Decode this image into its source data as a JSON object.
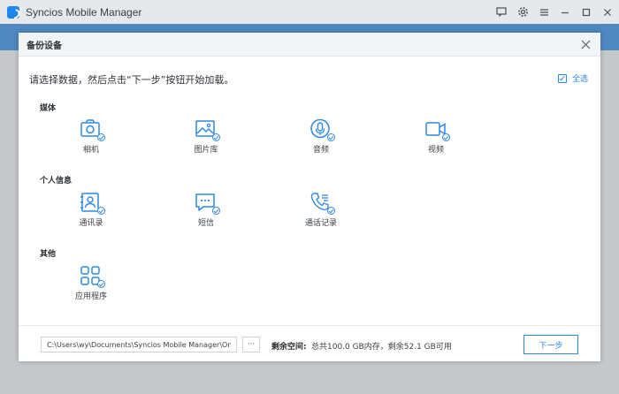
{
  "app": {
    "title": "Syncios Mobile Manager"
  },
  "dialog": {
    "title": "备份设备",
    "instruction": "请选择数据，然后点击“下一步”按钮开始加载。",
    "select_all_label": "全选",
    "sections": {
      "media": {
        "label": "媒体",
        "items": [
          {
            "label": "相机",
            "icon": "camera-icon"
          },
          {
            "label": "图片库",
            "icon": "photo-icon"
          },
          {
            "label": "音频",
            "icon": "microphone-icon"
          },
          {
            "label": "视频",
            "icon": "video-icon"
          }
        ]
      },
      "personal": {
        "label": "个人信息",
        "items": [
          {
            "label": "通讯录",
            "icon": "contacts-icon"
          },
          {
            "label": "短信",
            "icon": "message-icon"
          },
          {
            "label": "通话记录",
            "icon": "phone-icon"
          }
        ]
      },
      "other": {
        "label": "其他",
        "items": [
          {
            "label": "应用程序",
            "icon": "apps-icon"
          }
        ]
      }
    },
    "footer": {
      "path_value": "C:\\Users\\wy\\Documents\\Syncios Mobile Manager\\One Key Ba",
      "browse_label": "···",
      "space_label": "剩余空间:",
      "space_text": "总共100.0 GB内存，剩余52.1 GB可用",
      "next_label": "下一步"
    }
  },
  "colors": {
    "accent": "#2f88e4",
    "brand": "#1f86f0"
  }
}
